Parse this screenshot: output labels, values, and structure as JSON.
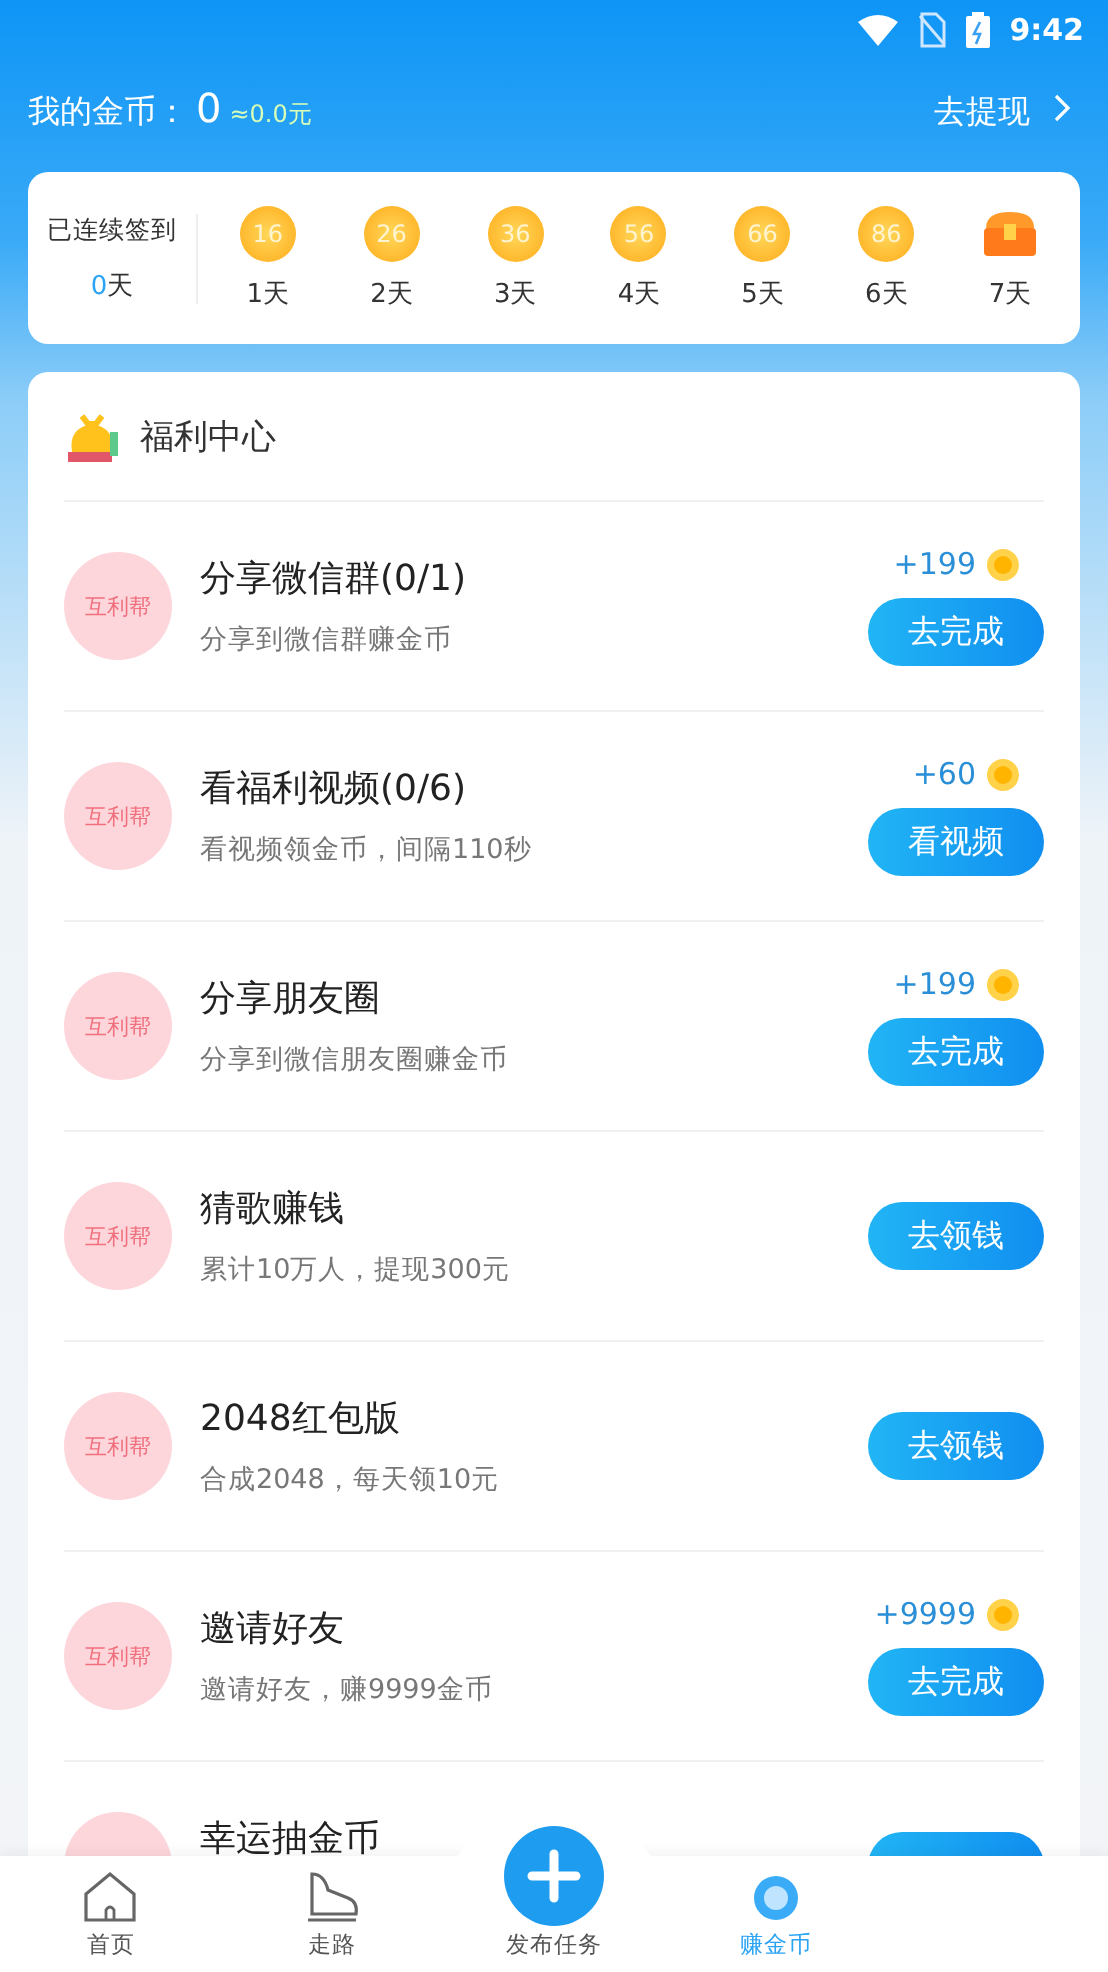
{
  "status_bar": {
    "time": "9:42"
  },
  "header": {
    "coins_label": "我的金币：",
    "coins": "0",
    "coins_value": "≈0.0元",
    "withdraw": "去提现"
  },
  "sign_in": {
    "label": "已连续签到",
    "streak_count": "0",
    "streak_unit": "天",
    "days": [
      {
        "kind": "coin",
        "amount": "16",
        "day": "1天"
      },
      {
        "kind": "coin",
        "amount": "26",
        "day": "2天"
      },
      {
        "kind": "coin",
        "amount": "36",
        "day": "3天"
      },
      {
        "kind": "coin",
        "amount": "56",
        "day": "4天"
      },
      {
        "kind": "coin",
        "amount": "66",
        "day": "5天"
      },
      {
        "kind": "coin",
        "amount": "86",
        "day": "6天"
      },
      {
        "kind": "chest",
        "day": "7天"
      }
    ]
  },
  "welfare": {
    "title": "福利中心",
    "tasks": [
      {
        "badge": "互利帮",
        "title": "分享微信群(0/1)",
        "desc": "分享到微信群赚金币",
        "reward": "+199",
        "button": "去完成"
      },
      {
        "badge": "互利帮",
        "title": "看福利视频(0/6)",
        "desc": "看视频领金币，间隔110秒",
        "reward": "+60",
        "button": "看视频"
      },
      {
        "badge": "互利帮",
        "title": "分享朋友圈",
        "desc": "分享到微信朋友圈赚金币",
        "reward": "+199",
        "button": "去完成"
      },
      {
        "badge": "互利帮",
        "title": "猜歌赚钱",
        "desc": "累计10万人，提现300元",
        "button": "去领钱"
      },
      {
        "badge": "互利帮",
        "title": "2048红包版",
        "desc": "合成2048，每天领10元",
        "button": "去领钱"
      },
      {
        "badge": "互利帮",
        "title": "邀请好友",
        "desc": "邀请好友，赚9999金币",
        "reward": "+9999",
        "button": "去完成"
      },
      {
        "title": "幸运抽金币"
      }
    ]
  },
  "tab_bar": [
    {
      "kind": "home",
      "label": "首页",
      "selected": false
    },
    {
      "kind": "shoe",
      "label": "走路",
      "selected": false
    },
    {
      "kind": "publish",
      "label": "发布任务",
      "selected": false
    },
    {
      "kind": "coins",
      "label": "赚金币",
      "selected": true
    }
  ]
}
